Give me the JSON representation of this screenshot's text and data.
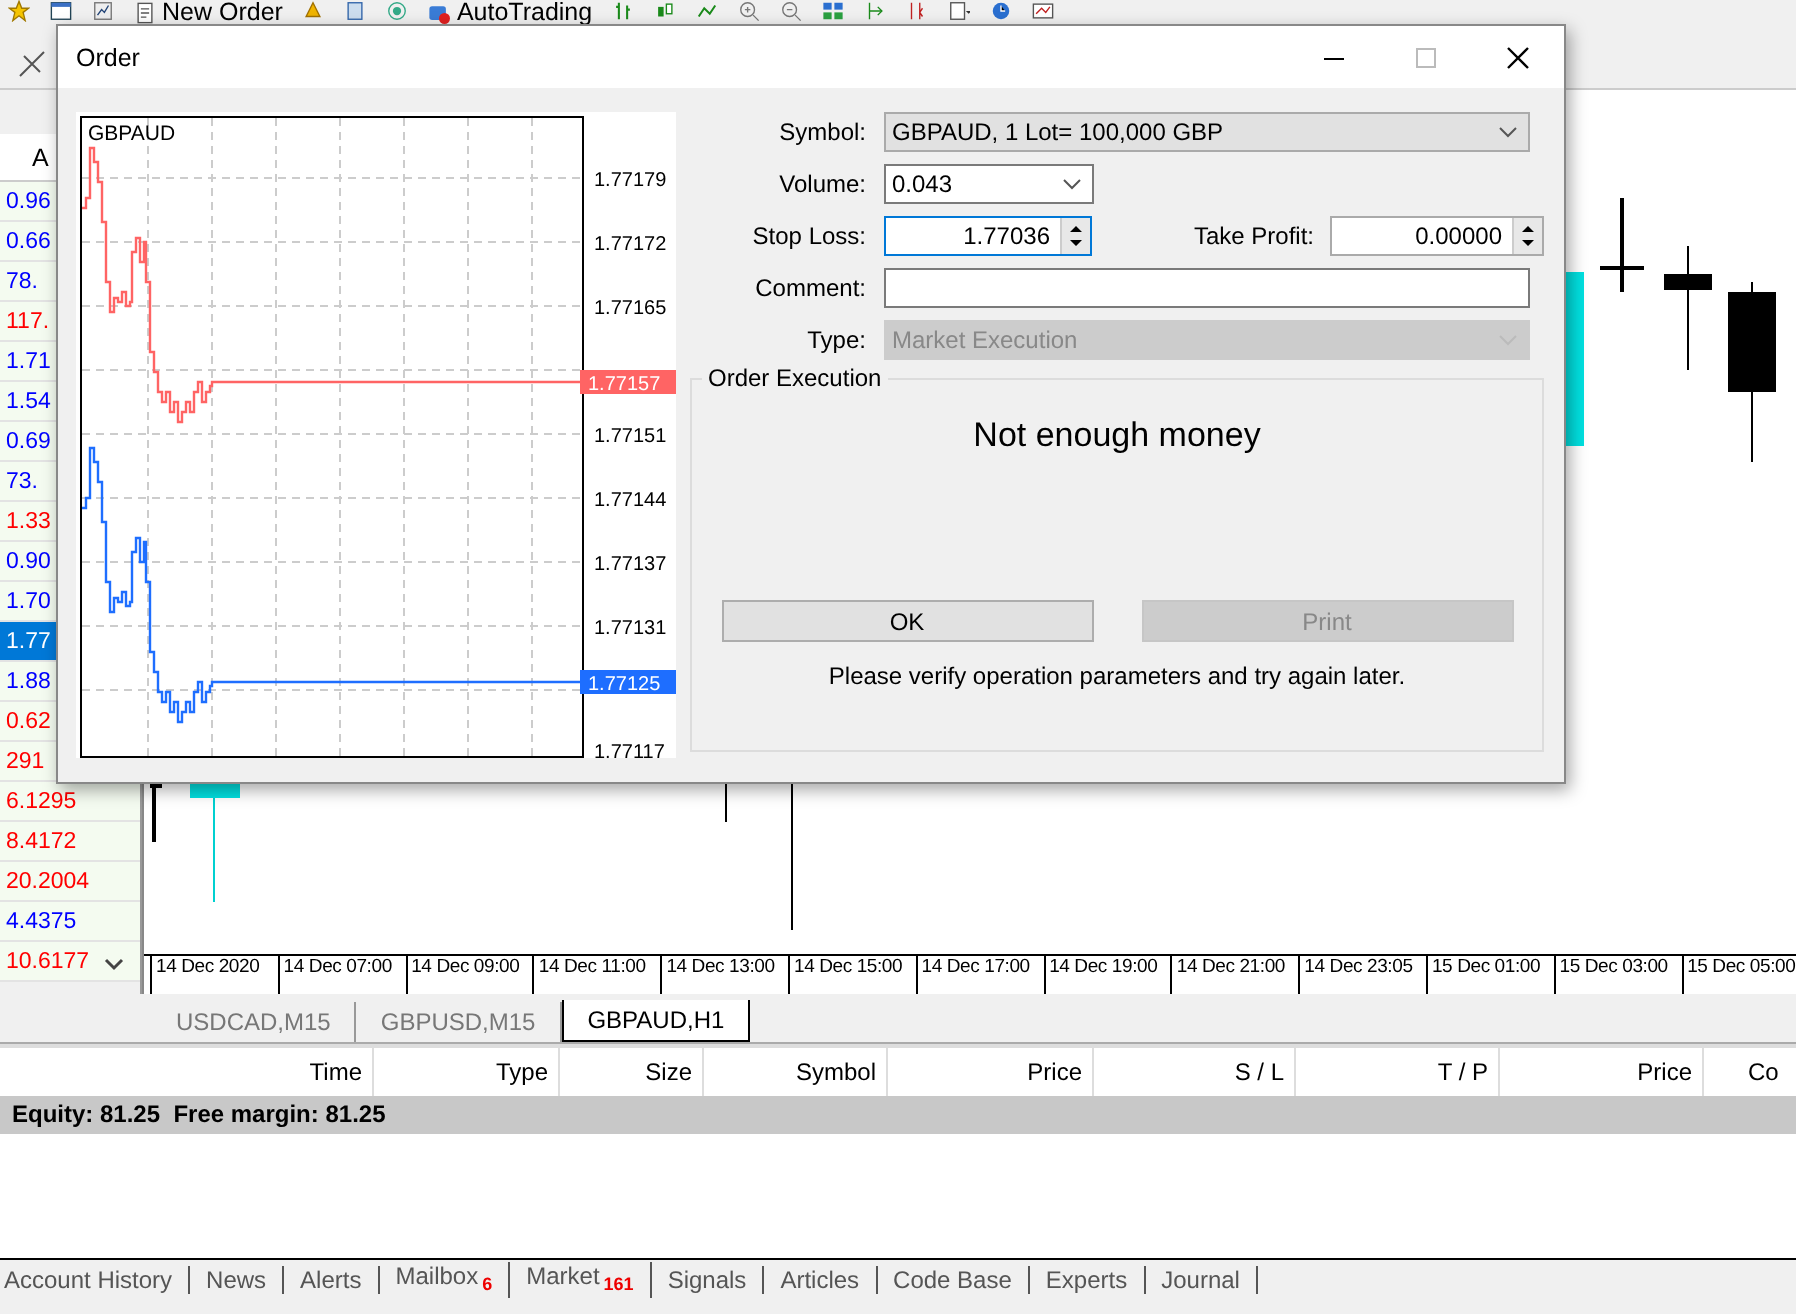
{
  "toolbar": {
    "buttons": [
      {
        "label": "New Order"
      },
      {
        "label": "AutoTrading"
      }
    ]
  },
  "market_watch": {
    "column_header": "A",
    "rows": [
      {
        "value": "0.96",
        "color": "#0000ff",
        "selected": false
      },
      {
        "value": "0.66",
        "color": "#0000ff",
        "selected": false
      },
      {
        "value": "78.",
        "color": "#0000ff",
        "selected": false
      },
      {
        "value": "117.",
        "color": "#ff0000",
        "selected": false
      },
      {
        "value": "1.71",
        "color": "#0000ff",
        "selected": false
      },
      {
        "value": "1.54",
        "color": "#0000ff",
        "selected": false
      },
      {
        "value": "0.69",
        "color": "#0000ff",
        "selected": false
      },
      {
        "value": "73.",
        "color": "#0000ff",
        "selected": false
      },
      {
        "value": "1.33",
        "color": "#ff0000",
        "selected": false
      },
      {
        "value": "0.90",
        "color": "#0000ff",
        "selected": false
      },
      {
        "value": "1.70",
        "color": "#0000ff",
        "selected": false
      },
      {
        "value": "1.77",
        "selected": true
      },
      {
        "value": "1.88",
        "color": "#0000ff",
        "selected": false
      },
      {
        "value": "0.62",
        "color": "#ff0000",
        "selected": false
      },
      {
        "value": "291",
        "color": "#ff0000",
        "selected": false
      },
      {
        "value": "6.1295",
        "color": "#ff0000",
        "selected": false
      },
      {
        "value": "8.4172",
        "color": "#ff0000",
        "selected": false
      },
      {
        "value": "20.2004",
        "color": "#ff0000",
        "selected": false
      },
      {
        "value": "4.4375",
        "color": "#0000ff",
        "selected": false
      },
      {
        "value": "10.6177",
        "color": "#ff0000",
        "selected": false
      }
    ]
  },
  "chart": {
    "time_labels": [
      "14 Dec 2020",
      "14 Dec 07:00",
      "14 Dec 09:00",
      "14 Dec 11:00",
      "14 Dec 13:00",
      "14 Dec 15:00",
      "14 Dec 17:00",
      "14 Dec 19:00",
      "14 Dec 21:00",
      "14 Dec 23:05",
      "15 Dec 01:00",
      "15 Dec 03:00",
      "15 Dec 05:00"
    ]
  },
  "chart_tabs": [
    {
      "label": "USDCAD,M15",
      "selected": false
    },
    {
      "label": "GBPUSD,M15",
      "selected": false
    },
    {
      "label": "GBPAUD,H1",
      "selected": true
    }
  ],
  "terminal": {
    "columns": [
      "Time",
      "Type",
      "Size",
      "Symbol",
      "Price",
      "S / L",
      "T / P",
      "Price",
      "Co"
    ],
    "summary": "Equity: 81.25  Free margin: 81.25",
    "tabs": [
      {
        "label": "Account History"
      },
      {
        "label": "News"
      },
      {
        "label": "Alerts"
      },
      {
        "label": "Mailbox",
        "badge": "6"
      },
      {
        "label": "Market",
        "badge": "161"
      },
      {
        "label": "Signals"
      },
      {
        "label": "Articles"
      },
      {
        "label": "Code Base"
      },
      {
        "label": "Experts"
      },
      {
        "label": "Journal"
      }
    ]
  },
  "order_dialog": {
    "title": "Order",
    "tick_chart": {
      "symbol": "GBPAUD",
      "price_labels": [
        "1.77179",
        "1.77172",
        "1.77165",
        "1.77151",
        "1.77144",
        "1.77137",
        "1.77131",
        "1.77117"
      ],
      "tags": [
        {
          "label": "1.77157",
          "color": "#ff6464"
        },
        {
          "label": "1.77125",
          "color": "#1e6eff"
        }
      ]
    },
    "symbol": {
      "label": "Symbol:",
      "value": "GBPAUD, 1 Lot= 100,000 GBP"
    },
    "volume": {
      "label": "Volume:",
      "value": "0.043"
    },
    "stop_loss": {
      "label": "Stop Loss:",
      "value": "1.77036"
    },
    "take_profit": {
      "label": "Take Profit:",
      "value": "0.00000"
    },
    "comment": {
      "label": "Comment:"
    },
    "type": {
      "label": "Type:",
      "value": "Market Execution",
      "disabled": true
    },
    "execution": {
      "title": "Order Execution",
      "message": "Not enough money",
      "buttons": [
        {
          "label": "OK",
          "disabled": false
        },
        {
          "label": "Print",
          "disabled": true
        }
      ],
      "note": "Please verify operation parameters and try again later."
    }
  }
}
